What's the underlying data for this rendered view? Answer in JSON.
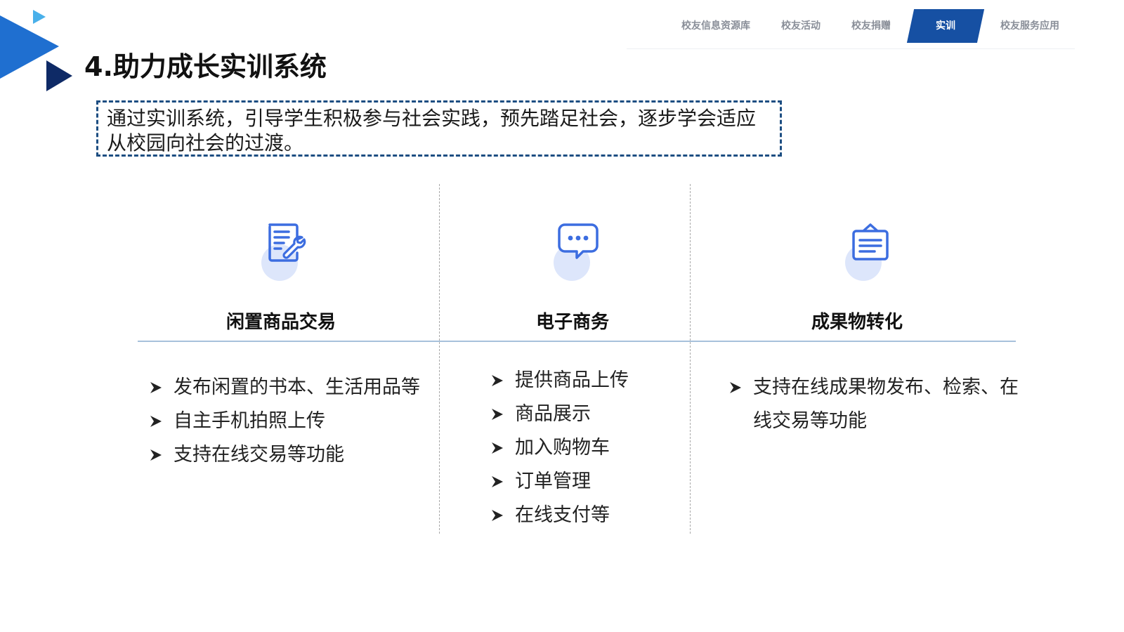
{
  "nav": {
    "items": [
      {
        "label": "校友信息资源库"
      },
      {
        "label": "校友活动"
      },
      {
        "label": "校友捐赠"
      },
      {
        "label": "实训"
      },
      {
        "label": "校友服务应用"
      }
    ],
    "active_index": 3
  },
  "title": "4.助力成长实训系统",
  "intro": "通过实训系统，引导学生积极参与社会实践，预先踏足社会，逐步学会适应从校园向社会的过渡。",
  "columns": [
    {
      "icon": "edit-wrench-icon",
      "heading": "闲置商品交易",
      "bullets": [
        "发布闲置的书本、生活用品等",
        "自主手机拍照上传",
        "支持在线交易等功能"
      ]
    },
    {
      "icon": "chat-bubble-icon",
      "heading": "电子商务",
      "bullets": [
        "提供商品上传",
        "商品展示",
        "加入购物车",
        "订单管理",
        "在线支付等"
      ]
    },
    {
      "icon": "clipboard-list-icon",
      "heading": "成果物转化",
      "bullets": [
        "支持在线成果物发布、检索、在线交易等功能"
      ]
    }
  ],
  "colors": {
    "accent": "#1650a3",
    "icon_blue": "#3c6de0",
    "deco_light": "#3aa0e6",
    "deco_mid": "#1f6fd0",
    "deco_dark": "#0e2a66",
    "box_border": "#1d4e82",
    "divider": "#a7c1db"
  }
}
